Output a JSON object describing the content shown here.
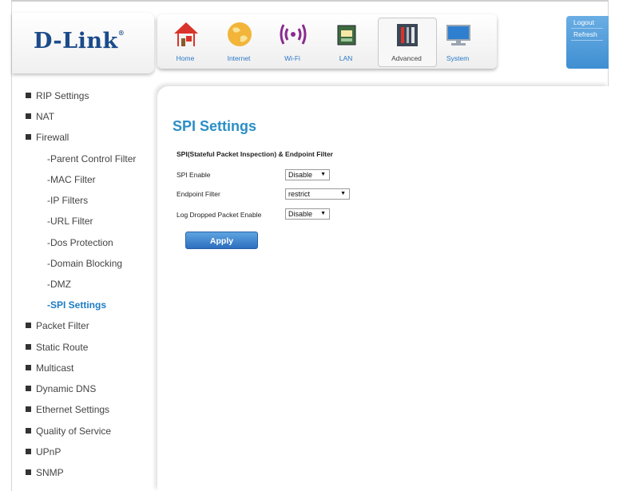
{
  "brand": {
    "logo": "D-Link"
  },
  "nav": [
    {
      "label": "Home",
      "icon": "home-icon"
    },
    {
      "label": "Internet",
      "icon": "globe-icon"
    },
    {
      "label": "Wi-Fi",
      "icon": "wifi-icon"
    },
    {
      "label": "LAN",
      "icon": "lan-icon"
    },
    {
      "label": "Advanced",
      "icon": "tools-icon"
    },
    {
      "label": "System",
      "icon": "monitor-icon"
    }
  ],
  "session": {
    "logout": "Logout",
    "refresh": "Refresh"
  },
  "sidebar": {
    "items": [
      {
        "label": "RIP Settings",
        "level": "top"
      },
      {
        "label": "NAT",
        "level": "top"
      },
      {
        "label": "Firewall",
        "level": "top"
      },
      {
        "label": "-Parent Control Filter",
        "level": "sub"
      },
      {
        "label": "-MAC Filter",
        "level": "sub"
      },
      {
        "label": "-IP Filters",
        "level": "sub"
      },
      {
        "label": "-URL Filter",
        "level": "sub"
      },
      {
        "label": "-Dos Protection",
        "level": "sub"
      },
      {
        "label": "-Domain Blocking",
        "level": "sub"
      },
      {
        "label": "-DMZ",
        "level": "sub"
      },
      {
        "label": "-SPI Settings",
        "level": "sub",
        "active": true
      },
      {
        "label": "Packet Filter",
        "level": "top"
      },
      {
        "label": "Static Route",
        "level": "top"
      },
      {
        "label": "Multicast",
        "level": "top"
      },
      {
        "label": "Dynamic DNS",
        "level": "top"
      },
      {
        "label": "Ethernet Settings",
        "level": "top"
      },
      {
        "label": "Quality of Service",
        "level": "top"
      },
      {
        "label": "UPnP",
        "level": "top"
      },
      {
        "label": "SNMP",
        "level": "top"
      }
    ]
  },
  "main": {
    "title": "SPI Settings",
    "section": "SPI(Stateful Packet Inspection) & Endpoint Filter",
    "fields": [
      {
        "label": "SPI Enable",
        "value": "Disable"
      },
      {
        "label": "Endpoint Filter",
        "value": "restrict"
      },
      {
        "label": "Log Dropped Packet Enable",
        "value": "Disable"
      }
    ],
    "apply_label": "Apply"
  },
  "colors": {
    "accent": "#2a8fc6",
    "brand": "#1b4b8a",
    "active_link": "#1d7cc4"
  }
}
